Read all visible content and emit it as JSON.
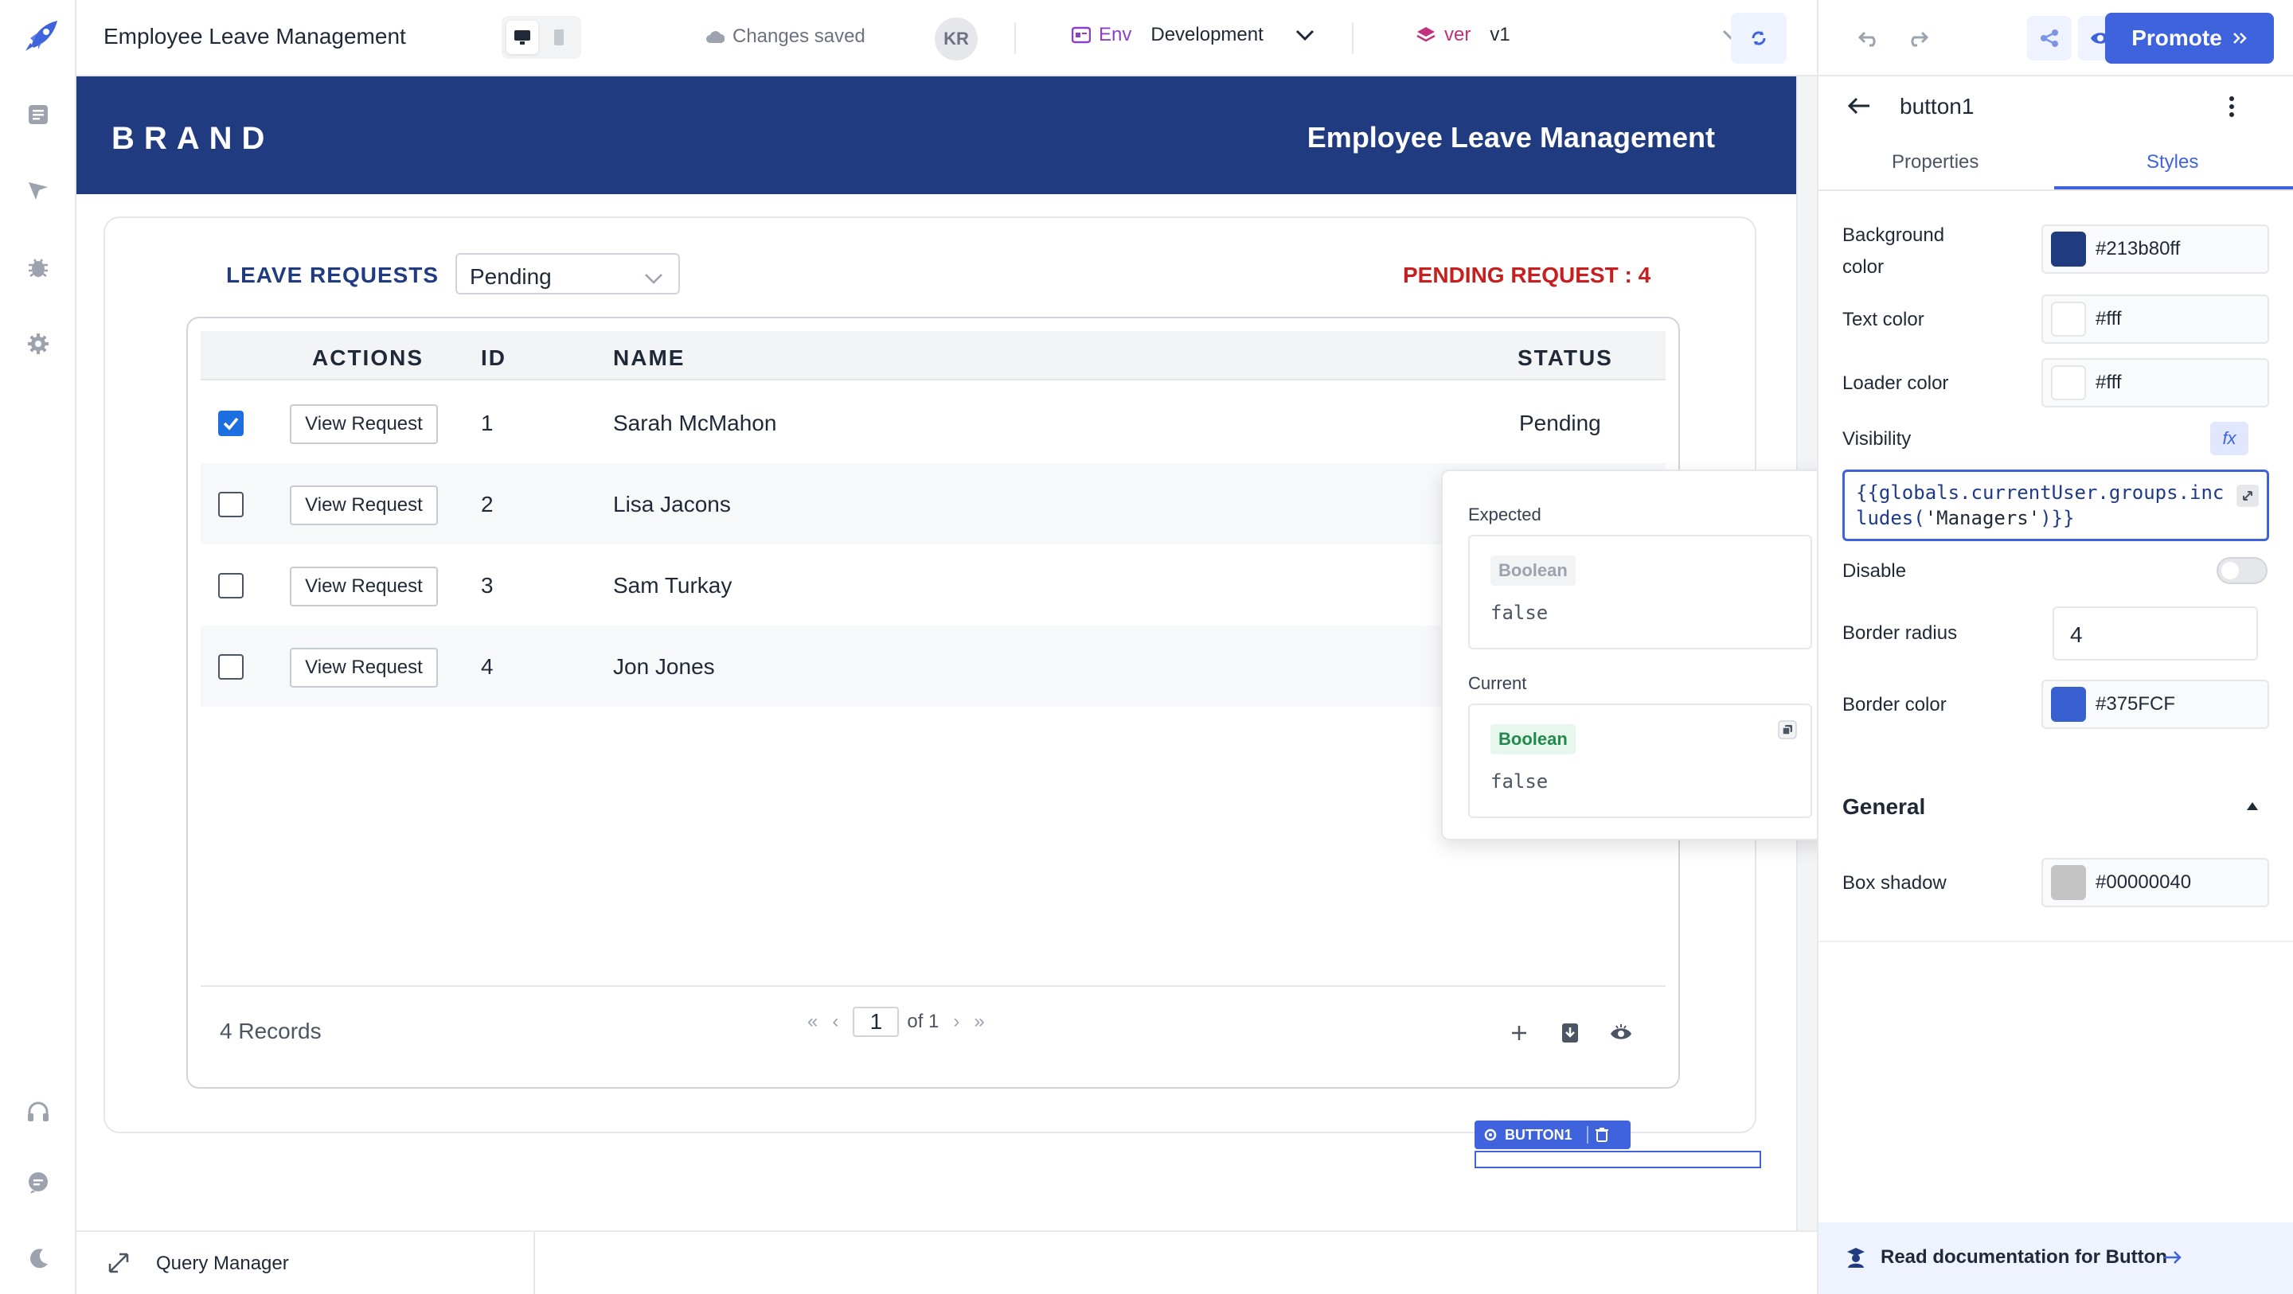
{
  "app": {
    "title": "Employee Leave Management",
    "changes_status": "Changes saved",
    "user_initials": "KR",
    "env_label": "Env",
    "env_value": "Development",
    "ver_label": "ver",
    "ver_value": "v1",
    "promote_label": "Promote"
  },
  "header": {
    "brand": "BRAND",
    "title": "Employee Leave Management"
  },
  "leave": {
    "section_title": "LEAVE REQUESTS",
    "filter_value": "Pending",
    "pending_count": "PENDING REQUEST : 4"
  },
  "table": {
    "columns": [
      "ACTIONS",
      "ID",
      "NAME",
      "STATUS"
    ],
    "action_label": "View Request",
    "rows": [
      {
        "checked": true,
        "id": "1",
        "name": "Sarah McMahon",
        "status": "Pending"
      },
      {
        "checked": false,
        "id": "2",
        "name": "Lisa Jacons",
        "status": ""
      },
      {
        "checked": false,
        "id": "3",
        "name": "Sam Turkay",
        "status": ""
      },
      {
        "checked": false,
        "id": "4",
        "name": "Jon Jones",
        "status": ""
      }
    ],
    "records": "4 Records",
    "page": "1",
    "page_of": "of 1"
  },
  "popover": {
    "expected_label": "Expected",
    "expected_type": "Boolean",
    "expected_value": "false",
    "current_label": "Current",
    "current_type": "Boolean",
    "current_value": "false"
  },
  "widget_tag": "BUTTON1",
  "query_manager": "Query Manager",
  "inspector": {
    "component": "button1",
    "tabs": [
      "Properties",
      "Styles"
    ],
    "active_tab": "Styles",
    "background_color_label": "Background color",
    "background_color": "#213b80ff",
    "text_color_label": "Text color",
    "text_color": "#fff",
    "loader_color_label": "Loader color",
    "loader_color": "#fff",
    "visibility_label": "Visibility",
    "fx_label": "fx",
    "visibility_code_a": "{{globals.currentUser.groups.includes(",
    "visibility_code_b": "'Managers'",
    "visibility_code_c": ")}}",
    "disable_label": "Disable",
    "disable_on": false,
    "border_radius_label": "Border radius",
    "border_radius": "4",
    "border_color_label": "Border color",
    "border_color": "#375FCF",
    "general_label": "General",
    "box_shadow_label": "Box shadow",
    "box_shadow": "#00000040",
    "docs_label": "Read documentation for Button"
  },
  "colors": {
    "brand_blue": "#213b80",
    "accent": "#3e63dd",
    "danger": "#c81e1e"
  }
}
